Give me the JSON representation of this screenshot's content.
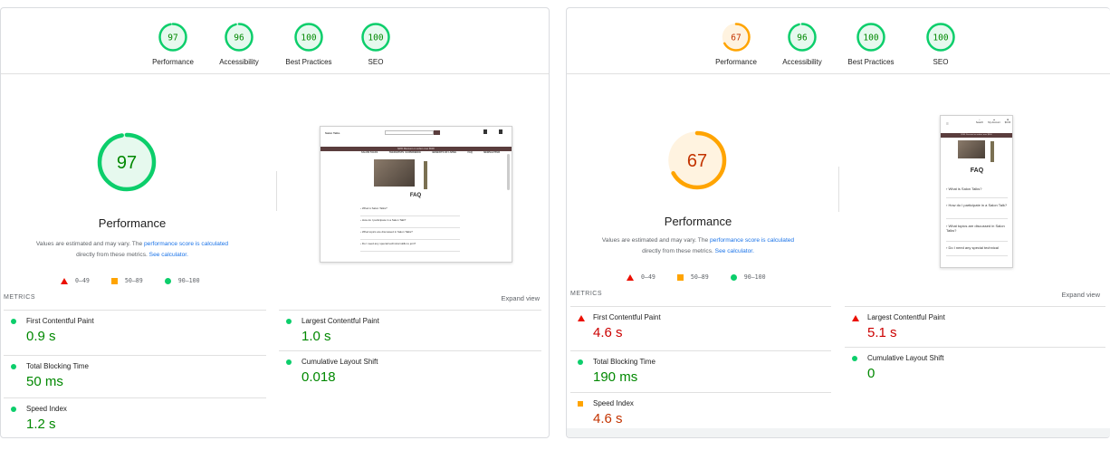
{
  "desktop": {
    "gauges": [
      {
        "score": "97",
        "label": "Performance",
        "color": "#0cce6b",
        "text_color": "#008800",
        "bg": "#e6f9ee",
        "fraction": 0.97
      },
      {
        "score": "96",
        "label": "Accessibility",
        "color": "#0cce6b",
        "text_color": "#008800",
        "bg": "#e6f9ee",
        "fraction": 0.96
      },
      {
        "score": "100",
        "label": "Best Practices",
        "color": "#0cce6b",
        "text_color": "#008800",
        "bg": "#e6f9ee",
        "fraction": 1.0
      },
      {
        "score": "100",
        "label": "SEO",
        "color": "#0cce6b",
        "text_color": "#008800",
        "bg": "#e6f9ee",
        "fraction": 1.0
      }
    ],
    "big_gauge": {
      "score": "97",
      "color": "#0cce6b",
      "text_color": "#008800",
      "bg": "#e6f9ee",
      "fraction": 0.97
    },
    "perf_title": "Performance",
    "desc_prefix": "Values are estimated and may vary. The ",
    "desc_link1": "performance score is calculated",
    "desc_middle": " directly from these metrics. ",
    "desc_link2": "See calculator.",
    "legend": {
      "fail": "0–49",
      "average": "50–89",
      "pass": "90–100"
    },
    "metrics_heading": "METRICS",
    "expand_label": "Expand view",
    "screenshot": {
      "brand": "Salon Talks",
      "nav": [
        "SALON TALKS",
        "THERAPISTS / EXPERIENCE",
        "BENEFITS OF LIVING",
        "FAQ",
        "NEWSLETTER"
      ],
      "banner": "$265 Discount on orders over $500",
      "faq_title": "FAQ",
      "questions": [
        "What is Salon Talks?",
        "How do I participate in a Salon Talk?",
        "What topics are discussed in Salon Talks?",
        "Do I need any special technical skills to join?"
      ]
    },
    "metrics": [
      {
        "title": "First Contentful Paint",
        "value": "0.9 s",
        "status": "pass"
      },
      {
        "title": "Largest Contentful Paint",
        "value": "1.0 s",
        "status": "pass"
      },
      {
        "title": "Total Blocking Time",
        "value": "50 ms",
        "status": "pass"
      },
      {
        "title": "Cumulative Layout Shift",
        "value": "0.018",
        "status": "pass"
      },
      {
        "title": "Speed Index",
        "value": "1.2 s",
        "status": "pass"
      }
    ]
  },
  "mobile": {
    "gauges": [
      {
        "score": "67",
        "label": "Performance",
        "color": "#ffa400",
        "text_color": "#c33300",
        "bg": "#fff3e0",
        "fraction": 0.67
      },
      {
        "score": "96",
        "label": "Accessibility",
        "color": "#0cce6b",
        "text_color": "#008800",
        "bg": "#e6f9ee",
        "fraction": 0.96
      },
      {
        "score": "100",
        "label": "Best Practices",
        "color": "#0cce6b",
        "text_color": "#008800",
        "bg": "#e6f9ee",
        "fraction": 1.0
      },
      {
        "score": "100",
        "label": "SEO",
        "color": "#0cce6b",
        "text_color": "#008800",
        "bg": "#e6f9ee",
        "fraction": 1.0
      }
    ],
    "big_gauge": {
      "score": "67",
      "color": "#ffa400",
      "text_color": "#c33300",
      "bg": "#fff3e0",
      "fraction": 0.67
    },
    "perf_title": "Performance",
    "desc_prefix": "Values are estimated and may vary. The ",
    "desc_link1": "performance score is calculated",
    "desc_middle": " directly from these metrics. ",
    "desc_link2": "See calculator.",
    "legend": {
      "fail": "0–49",
      "average": "50–89",
      "pass": "90–100"
    },
    "metrics_heading": "METRICS",
    "expand_label": "Expand view",
    "screenshot": {
      "icons": [
        "Search",
        "My Account",
        "$0.00"
      ],
      "banner": "$265 Discount on orders over $500",
      "faq_title": "FAQ",
      "questions": [
        "What is Salon Talks?",
        "How do I participate in a Salon Talk?",
        "What topics are discussed in Salon Talks?",
        "Do I need any special technical"
      ]
    },
    "metrics": [
      {
        "title": "First Contentful Paint",
        "value": "4.6 s",
        "status": "fail"
      },
      {
        "title": "Largest Contentful Paint",
        "value": "5.1 s",
        "status": "fail"
      },
      {
        "title": "Total Blocking Time",
        "value": "190 ms",
        "status": "pass"
      },
      {
        "title": "Cumulative Layout Shift",
        "value": "0",
        "status": "pass"
      },
      {
        "title": "Speed Index",
        "value": "4.6 s",
        "status": "average"
      }
    ]
  }
}
